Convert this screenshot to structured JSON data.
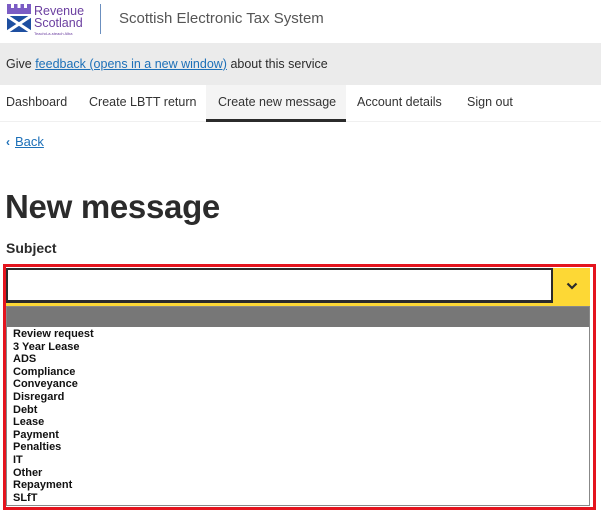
{
  "header": {
    "logo": {
      "line1": "Revenue",
      "line2": "Scotland",
      "tagline": "Teachd-a-steach Alba"
    },
    "title": "Scottish Electronic Tax System"
  },
  "feedback_banner": {
    "prefix": "Give ",
    "link_text": "feedback (opens in a new window)",
    "suffix": " about this service"
  },
  "nav": {
    "items": [
      {
        "label": "Dashboard",
        "active": false
      },
      {
        "label": "Create LBTT return",
        "active": false
      },
      {
        "label": "Create new message",
        "active": true
      },
      {
        "label": "Account details",
        "active": false
      },
      {
        "label": "Sign out",
        "active": false
      }
    ]
  },
  "back_link": {
    "icon": "chevron-left-icon",
    "label": "Back"
  },
  "page": {
    "title": "New message",
    "subject_label": "Subject"
  },
  "subject_select": {
    "value": "",
    "toggle_icon": "chevron-down-icon",
    "options": [
      "",
      "Review request",
      "3 Year Lease",
      "ADS",
      "Compliance",
      "Conveyance",
      "Disregard",
      "Debt",
      "Lease",
      "Payment",
      "Penalties",
      "IT",
      "Other",
      "Repayment",
      "SLfT"
    ]
  },
  "colors": {
    "brand_purple": "#6b3fa0",
    "link_blue": "#1d70b8",
    "focus_yellow": "#fdd835",
    "highlight_red": "#e4141e",
    "selected_option_gray": "#777777"
  }
}
